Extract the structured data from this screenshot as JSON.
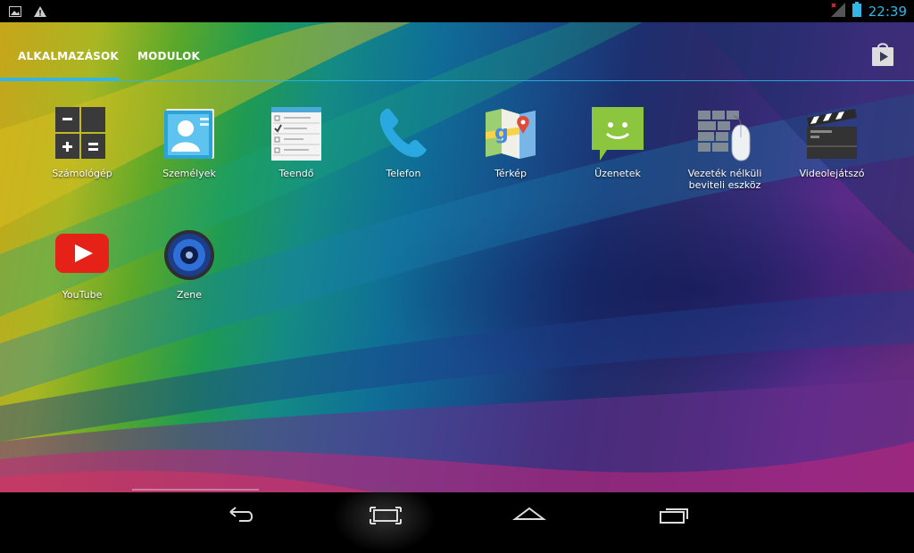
{
  "status_bar": {
    "time": "22:39",
    "icons": [
      "image-notification-icon",
      "warning-icon",
      "signal-icon",
      "battery-icon"
    ]
  },
  "tabs": [
    {
      "label": "ALKALMAZÁSOK",
      "selected": true
    },
    {
      "label": "MODULOK",
      "selected": false
    }
  ],
  "store_icon": "play-store-icon",
  "apps": [
    {
      "label": "Számológép",
      "icon": "calculator-icon"
    },
    {
      "label": "Személyek",
      "icon": "contacts-icon"
    },
    {
      "label": "Teendő",
      "icon": "todo-icon"
    },
    {
      "label": "Telefon",
      "icon": "phone-icon"
    },
    {
      "label": "Térkép",
      "icon": "maps-icon"
    },
    {
      "label": "Üzenetek",
      "icon": "messages-icon"
    },
    {
      "label": "Vezeték nélküli\nbeviteli eszköz",
      "icon": "wireless-input-icon"
    },
    {
      "label": "Videolejátszó",
      "icon": "video-player-icon"
    },
    {
      "label": "YouTube",
      "icon": "youtube-icon"
    },
    {
      "label": "Zene",
      "icon": "music-icon"
    }
  ],
  "nav": [
    "back-icon",
    "recent-screenshot-icon",
    "home-icon",
    "recent-apps-icon"
  ],
  "colors": {
    "accent": "#33b5e5"
  }
}
